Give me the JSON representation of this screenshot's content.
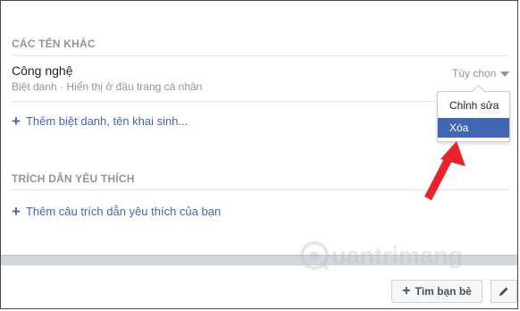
{
  "section_other_names": {
    "title": "CÁC TÊN KHÁC",
    "entry": {
      "name": "Công nghệ",
      "subtitle": "Biệt danh · Hiển thị ở đầu trang cá nhân",
      "options_label": "Tùy chọn"
    },
    "add_link": "Thêm biệt danh, tên khai sinh..."
  },
  "dropdown": {
    "items": [
      "Chỉnh sửa",
      "Xóa"
    ],
    "highlighted": "Xóa"
  },
  "section_quotes": {
    "title": "TRÍCH DẪN YÊU THÍCH",
    "add_link": "Thêm câu trích dẫn yêu thích của bạn"
  },
  "footer": {
    "find_friends_label": "Tìm bạn bè"
  },
  "watermark": {
    "text": "uantrimang"
  },
  "colors": {
    "accent": "#4267b2",
    "arrow": "#e8232a",
    "muted": "#90949c"
  }
}
